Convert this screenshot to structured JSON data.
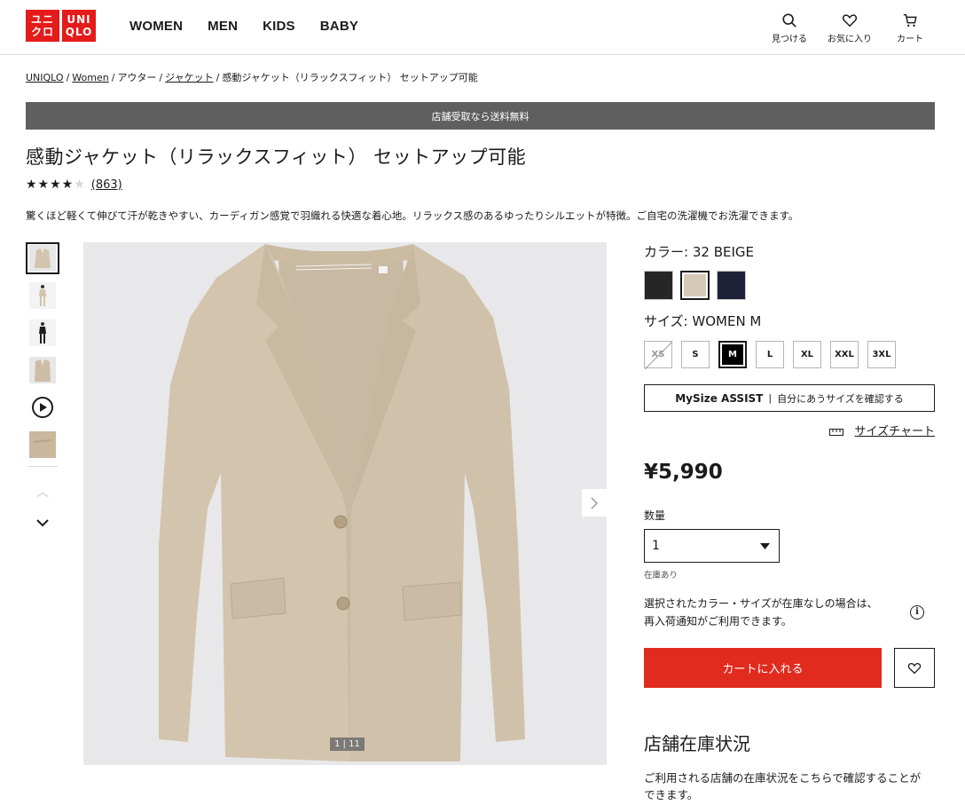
{
  "header": {
    "logo_top": "ユニ",
    "logo_bottom": "クロ",
    "logo_top_en": "UNI",
    "logo_bottom_en": "QLO",
    "nav": [
      "WOMEN",
      "MEN",
      "KIDS",
      "BABY"
    ],
    "search_label": "見つける",
    "favorites_label": "お気に入り",
    "cart_label": "カート"
  },
  "breadcrumb": {
    "items": [
      "UNIQLO",
      "Women",
      "アウター",
      "ジャケット",
      "感動ジャケット（リラックスフィット） セットアップ可能"
    ]
  },
  "banner": {
    "text": "店舗受取なら送料無料"
  },
  "product": {
    "title": "感動ジャケット（リラックスフィット） セットアップ可能",
    "rating_stars": 4,
    "review_count": "(863)",
    "description": "驚くほど軽くて伸びて汗が乾きやすい、カーディガン感覚で羽織れる快適な着心地。リラックス感のあるゆったりシルエットが特徴。ご自宅の洗濯機でお洗濯できます。"
  },
  "gallery": {
    "counter": "1 | 11",
    "thumb_count": 6
  },
  "options": {
    "color_label": "カラー:",
    "color_value": "32 BEIGE",
    "colors": [
      {
        "name": "black",
        "hex": "#262626"
      },
      {
        "name": "beige",
        "hex": "#d6c9b7"
      },
      {
        "name": "navy",
        "hex": "#1d2238"
      }
    ],
    "size_label": "サイズ:",
    "size_value": "WOMEN M",
    "sizes": [
      "XS",
      "S",
      "M",
      "L",
      "XL",
      "XXL",
      "3XL"
    ],
    "mysize_brand": "MySize ASSIST",
    "mysize_text": "自分にあうサイズを確認する",
    "size_chart": "サイズチャート"
  },
  "purchase": {
    "price": "¥5,990",
    "qty_label": "数量",
    "qty_value": "1",
    "stock": "在庫あり",
    "notify_line1": "選択されたカラー・サイズが在庫なしの場合は、",
    "notify_line2": "再入荷通知がご利用できます。",
    "cart_button": "カートに入れる"
  },
  "store": {
    "title": "店舗在庫状況",
    "desc_line1": "ご利用される店舗の在庫状況をこちらで確認することが",
    "desc_line2": "できます。"
  },
  "colors": {
    "brand_red": "#e51a1a",
    "cart_red": "#e12b1f",
    "banner_gray": "#5f5f5f",
    "jacket_beige": "#d3c4ad"
  }
}
